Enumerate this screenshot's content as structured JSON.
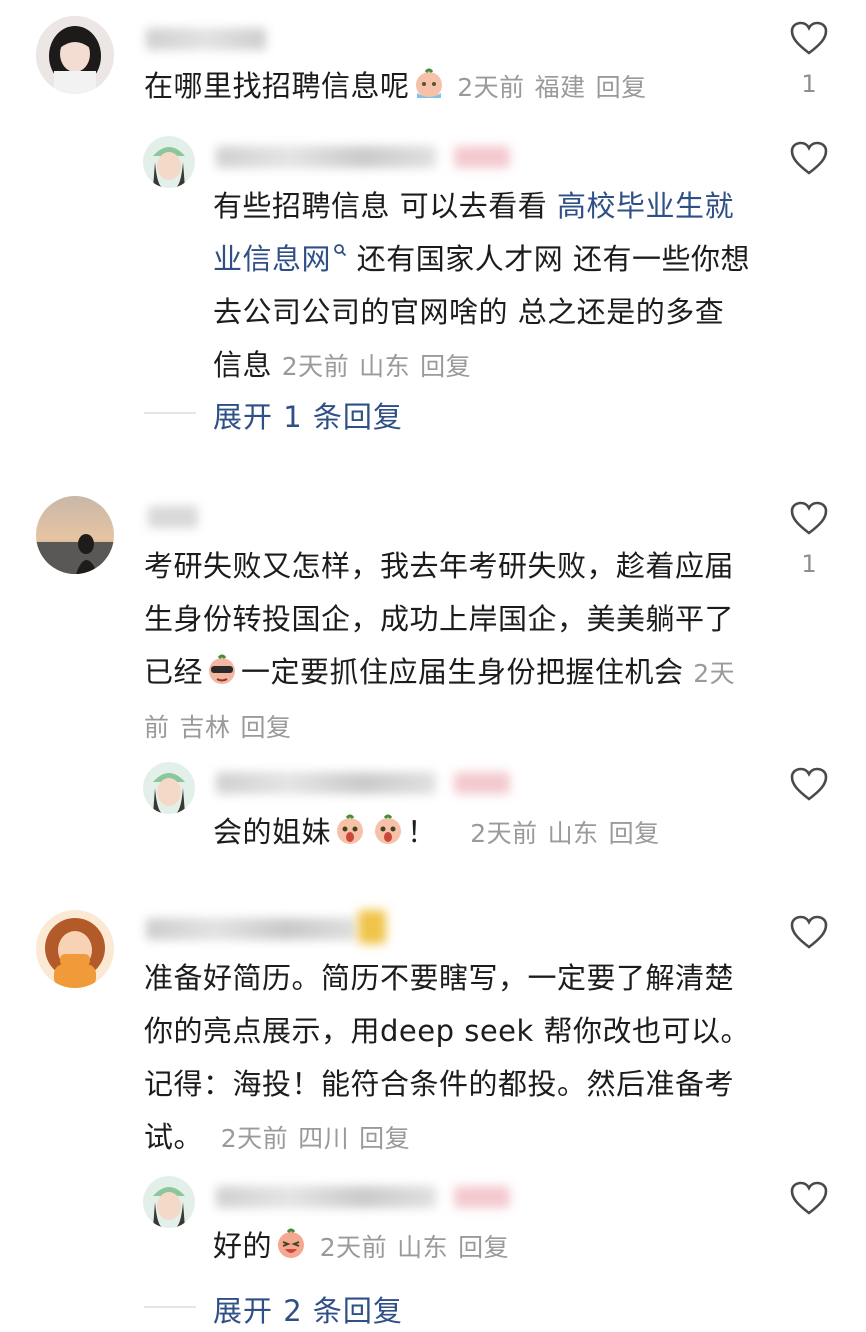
{
  "comments": [
    {
      "text": "在哪里找招聘信息呢",
      "emoji": "crying-face-emoji",
      "time": "2天前",
      "location": "福建",
      "reply_label": "回复",
      "like_count": "1"
    },
    {
      "text": "考研失败又怎样，我去年考研失败，趁着应届生身份转投国企，成功上岸国企，美美躺平了已经",
      "emoji": "sunglasses-face-emoji",
      "text2": "一定要抓住应届生身份把握住机会",
      "time": "2天前",
      "location": "吉林",
      "reply_label": "回复",
      "like_count": "1"
    },
    {
      "text": "准备好简历。简历不要瞎写，一定要了解清楚你的亮点展示，用deep seek 帮你改也可以。记得：海投！能符合条件的都投。然后准备考试。",
      "time": "2天前",
      "location": "四川",
      "reply_label": "回复"
    }
  ],
  "replies": [
    {
      "text_prefix": "有些招聘信息 可以去看看 ",
      "link_text": "高校毕业生就业信息网",
      "text_suffix": " 还有国家人才网 还有一些你想去公司公司的官网啥的 总之还是的多查信息",
      "time": "2天前",
      "location": "山东",
      "reply_label": "回复"
    },
    {
      "text": "会的姐妹",
      "text_end": "！",
      "time": "2天前",
      "location": "山东",
      "reply_label": "回复"
    },
    {
      "text": "好的",
      "time": "2天前",
      "location": "山东",
      "reply_label": "回复"
    }
  ],
  "expand": [
    {
      "label": "展开 1 条回复"
    },
    {
      "label": "展开 2 条回复"
    }
  ],
  "colors": {
    "link": "#2f4f87",
    "meta": "#9a9a9a",
    "text": "#1c1c1c"
  }
}
